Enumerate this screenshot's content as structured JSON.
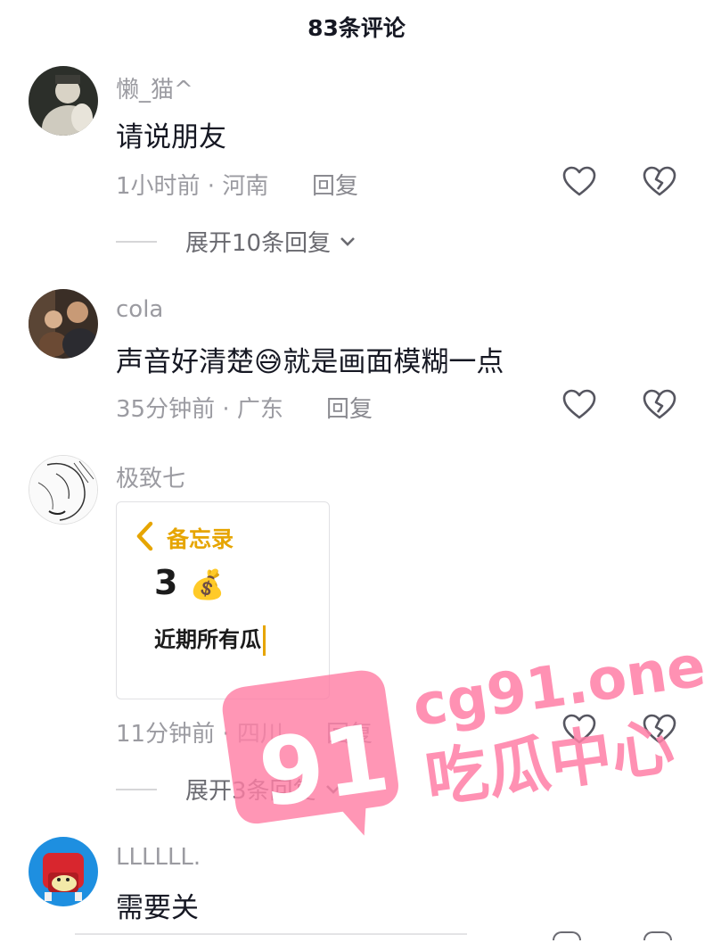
{
  "header": {
    "title": "83条评论"
  },
  "comments": [
    {
      "username": "懒_猫^",
      "content": "请说朋友",
      "time": "1小时前 · 河南",
      "reply": "回复",
      "expand": "展开10条回复"
    },
    {
      "username": "cola",
      "content_before": "声音好清楚",
      "content_emoji": "😅",
      "content_after": "就是画面模糊一点",
      "time": "35分钟前 · 广东",
      "reply": "回复"
    },
    {
      "username": "极致七",
      "image": {
        "back_title": "备忘录",
        "number": "3",
        "money_emoji": "💰",
        "text": "近期所有瓜"
      },
      "time": "11分钟前 · 四川",
      "reply": "回复",
      "expand": "展开3条回复"
    },
    {
      "username": "LLLLLL.",
      "content": "需要关"
    }
  ],
  "watermark": {
    "number": "91",
    "domain": "cg91.one",
    "slogan": "吃瓜中心",
    "color": "#ff7fa6"
  },
  "icons": [
    "heart-outline-icon",
    "broken-heart-icon",
    "chevron-down-icon",
    "chevron-left-icon"
  ]
}
